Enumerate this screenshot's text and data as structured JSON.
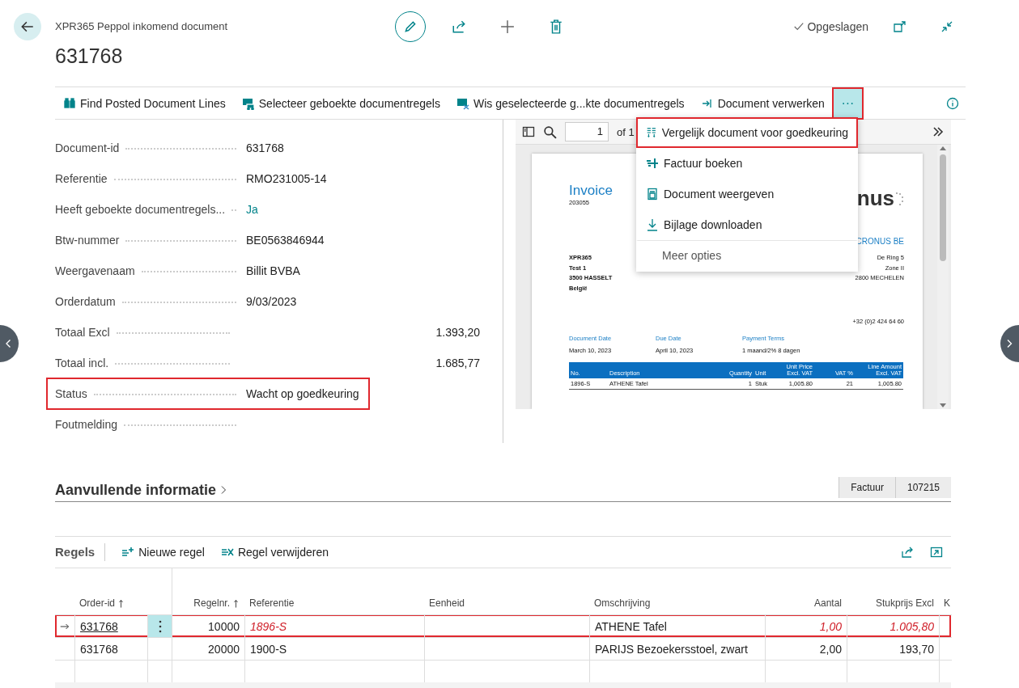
{
  "header": {
    "breadcrumb": "XPR365 Peppol inkomend document",
    "title": "631768",
    "save_status": "Opgeslagen"
  },
  "toolbar": {
    "actions": [
      {
        "label": "Find Posted Document Lines"
      },
      {
        "label": "Selecteer geboekte documentregels"
      },
      {
        "label": "Wis geselecteerde g...kte documentregels"
      },
      {
        "label": "Document verwerken"
      }
    ],
    "more_button": {
      "label": "···",
      "highlighted": true
    }
  },
  "fields": [
    {
      "label": "Document-id",
      "value": "631768",
      "kind": "text",
      "highlighted": false
    },
    {
      "label": "Referentie",
      "value": "RMO231005-14",
      "kind": "text",
      "highlighted": false
    },
    {
      "label": "Heeft geboekte documentregels...",
      "value": "Ja",
      "kind": "link",
      "highlighted": false
    },
    {
      "label": "Btw-nummer",
      "value": "BE0563846944",
      "kind": "text",
      "highlighted": false
    },
    {
      "label": "Weergavenaam",
      "value": "Billit BVBA",
      "kind": "text",
      "highlighted": false
    },
    {
      "label": "Orderdatum",
      "value": "9/03/2023",
      "kind": "text",
      "highlighted": false
    },
    {
      "label": "Totaal Excl",
      "value": "1.393,20",
      "kind": "amount",
      "highlighted": false
    },
    {
      "label": "Totaal incl.",
      "value": "1.685,77",
      "kind": "amount",
      "highlighted": false
    },
    {
      "label": "Status",
      "value": "Wacht op goedkeuring",
      "kind": "text",
      "highlighted": true
    },
    {
      "label": "Foutmelding",
      "kind": "text",
      "highlighted": false
    }
  ],
  "viewer": {
    "page_input": "1",
    "page_count": "of 1",
    "invoice": {
      "title": "Invoice",
      "number": "203055",
      "logo_fragment": "nus",
      "company": "CRONUS BE",
      "bill_to": [
        "XPR365",
        "Test 1",
        "3500 HASSELT",
        "België"
      ],
      "company_address": [
        "De Ring 5",
        "Zone II",
        "2800 MECHELEN"
      ],
      "phone": "+32 (0)2 424 64 60",
      "dates": [
        {
          "label": "Document Date",
          "value": "March 10, 2023"
        },
        {
          "label": "Due Date",
          "value": "April 10, 2023"
        },
        {
          "label": "Payment Terms",
          "value": "1 maand/2% 8 dagen"
        }
      ],
      "columns": [
        "No.",
        "Description",
        "Quantity",
        "Unit",
        "Unit Price Excl. VAT",
        "VAT %",
        "Line Amount Excl. VAT"
      ],
      "rows": [
        [
          "1896-S",
          "ATHENE Tafel",
          "1",
          "Stuk",
          "1,005.80",
          "21",
          "1,005.80"
        ]
      ]
    }
  },
  "menu": {
    "items": [
      {
        "label": "Vergelijk document voor goedkeuring",
        "kind": "action",
        "highlighted": true
      },
      {
        "label": "Factuur boeken",
        "kind": "action",
        "highlighted": false
      },
      {
        "label": "Document weergeven",
        "kind": "action",
        "highlighted": false
      },
      {
        "label": "Bijlage downloaden",
        "kind": "action",
        "highlighted": false
      },
      {
        "label": "Meer opties",
        "kind": "more",
        "highlighted": false
      }
    ]
  },
  "additional_info": {
    "title": "Aanvullende informatie",
    "badges": [
      "Factuur",
      "107215"
    ]
  },
  "lines": {
    "title": "Regels",
    "actions": [
      {
        "label": "Nieuwe regel"
      },
      {
        "label": "Regel verwijderen"
      }
    ],
    "columns": [
      {
        "label": "Order-id",
        "sorted": true
      },
      {
        "label": "Regelnr.",
        "sorted": true
      },
      {
        "label": "Referentie",
        "sorted": false
      },
      {
        "label": "Eenheid",
        "sorted": false
      },
      {
        "label": "Omschrijving",
        "sorted": false
      },
      {
        "label": "Aantal",
        "sorted": false
      },
      {
        "label": "Stukprijs Excl",
        "sorted": false
      },
      {
        "label": "K"
      }
    ],
    "rows": [
      {
        "selected": true,
        "highlighted": true,
        "order_id": {
          "text": "631768",
          "error": false
        },
        "line_no": {
          "text": "10000",
          "error": false
        },
        "reference": {
          "text": "1896-S",
          "error": true
        },
        "description": {
          "text": "ATHENE Tafel",
          "error": false
        },
        "quantity": {
          "text": "1,00",
          "error": true
        },
        "unit_price": {
          "text": "1.005,80",
          "error": true
        }
      },
      {
        "selected": false,
        "highlighted": false,
        "order_id": {
          "text": "631768",
          "error": false
        },
        "line_no": {
          "text": "20000",
          "error": false
        },
        "reference": {
          "text": "1900-S",
          "error": false
        },
        "description": {
          "text": "PARIJS Bezoekersstoel, zwart",
          "error": false
        },
        "quantity": {
          "text": "2,00",
          "error": false
        },
        "unit_price": {
          "text": "193,70",
          "error": false
        }
      }
    ]
  }
}
